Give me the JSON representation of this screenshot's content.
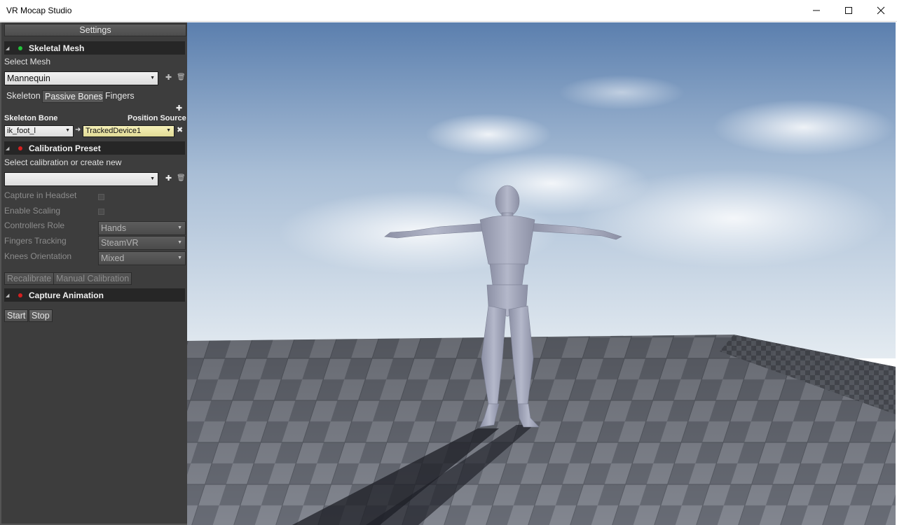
{
  "window": {
    "title": "VR Mocap Studio",
    "controls": {
      "minimize": "minimize-icon",
      "maximize": "maximize-icon",
      "close": "close-icon"
    }
  },
  "panel": {
    "header": "Settings",
    "skeletal_mesh": {
      "title": "Skeletal Mesh",
      "status_color": "#22c23a",
      "select_label": "Select Mesh",
      "selected_mesh": "Mannequin",
      "tabs": [
        "Skeleton",
        "Passive Bones",
        "Fingers"
      ],
      "active_tab": "Passive Bones",
      "col_bone": "Skeleton Bone",
      "col_source": "Position Source",
      "bone_value": "ik_foot_l",
      "source_value": "TrackedDevice1"
    },
    "calibration": {
      "title": "Calibration Preset",
      "status_color": "#d61f1f",
      "select_label": "Select calibration or create new",
      "selected_preset": "",
      "capture_in_headset": "Capture in Headset",
      "enable_scaling": "Enable Scaling",
      "controllers_role_label": "Controllers Role",
      "controllers_role_value": "Hands",
      "fingers_tracking_label": "Fingers Tracking",
      "fingers_tracking_value": "SteamVR",
      "knees_orientation_label": "Knees Orientation",
      "knees_orientation_value": "Mixed",
      "recalibrate": "Recalibrate",
      "manual_calibration": "Manual Calibration"
    },
    "capture": {
      "title": "Capture Animation",
      "status_color": "#d61f1f",
      "start": "Start",
      "stop": "Stop"
    }
  },
  "viewport": {
    "sky_top": "#5b7fae",
    "sky_bottom": "#e4ebf1",
    "floor_light": "#8a8f99",
    "floor_dark": "#4a4d55",
    "mannequin_color": "#a7abbe"
  }
}
